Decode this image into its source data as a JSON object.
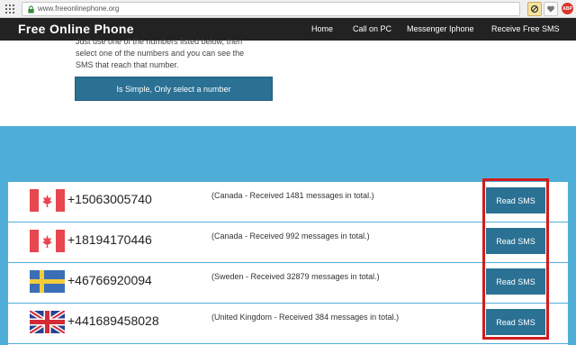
{
  "browser": {
    "url": "www.freeonlinephone.org",
    "ext_icons": [
      "block-icon",
      "heart-icon",
      "adblock-icon"
    ],
    "adblock_label": "ABP"
  },
  "nav": {
    "brand": "Free Online Phone",
    "links": [
      "Home",
      "Call on PC",
      "Messenger Iphone",
      "Receive Free SMS"
    ]
  },
  "intro": {
    "lines": [
      "Just use one of the numbers listed below, then",
      "select one of the numbers and you can see the",
      "SMS that reach that number."
    ],
    "button": "Is Simple, Only select a number"
  },
  "numbers": [
    {
      "flag": "canada-flag-icon",
      "phone": "+15063005740",
      "description": "(Canada - Received 1481 messages in total.)",
      "button": "Read SMS"
    },
    {
      "flag": "canada-flag-icon",
      "phone": "+18194170446",
      "description": "(Canada - Received 992 messages in total.)",
      "button": "Read SMS"
    },
    {
      "flag": "sweden-flag-icon",
      "phone": "+46766920094",
      "description": "(Sweden - Received 32879 messages in total.)",
      "button": "Read SMS"
    },
    {
      "flag": "uk-flag-icon",
      "phone": "+441689458028",
      "description": "(United Kingdom - Received 384 messages in total.)",
      "button": "Read SMS"
    }
  ],
  "colors": {
    "nav_bg": "#222222",
    "accent_button": "#2a7194",
    "band_bg": "#4faed8",
    "highlight": "#d11c1c"
  }
}
